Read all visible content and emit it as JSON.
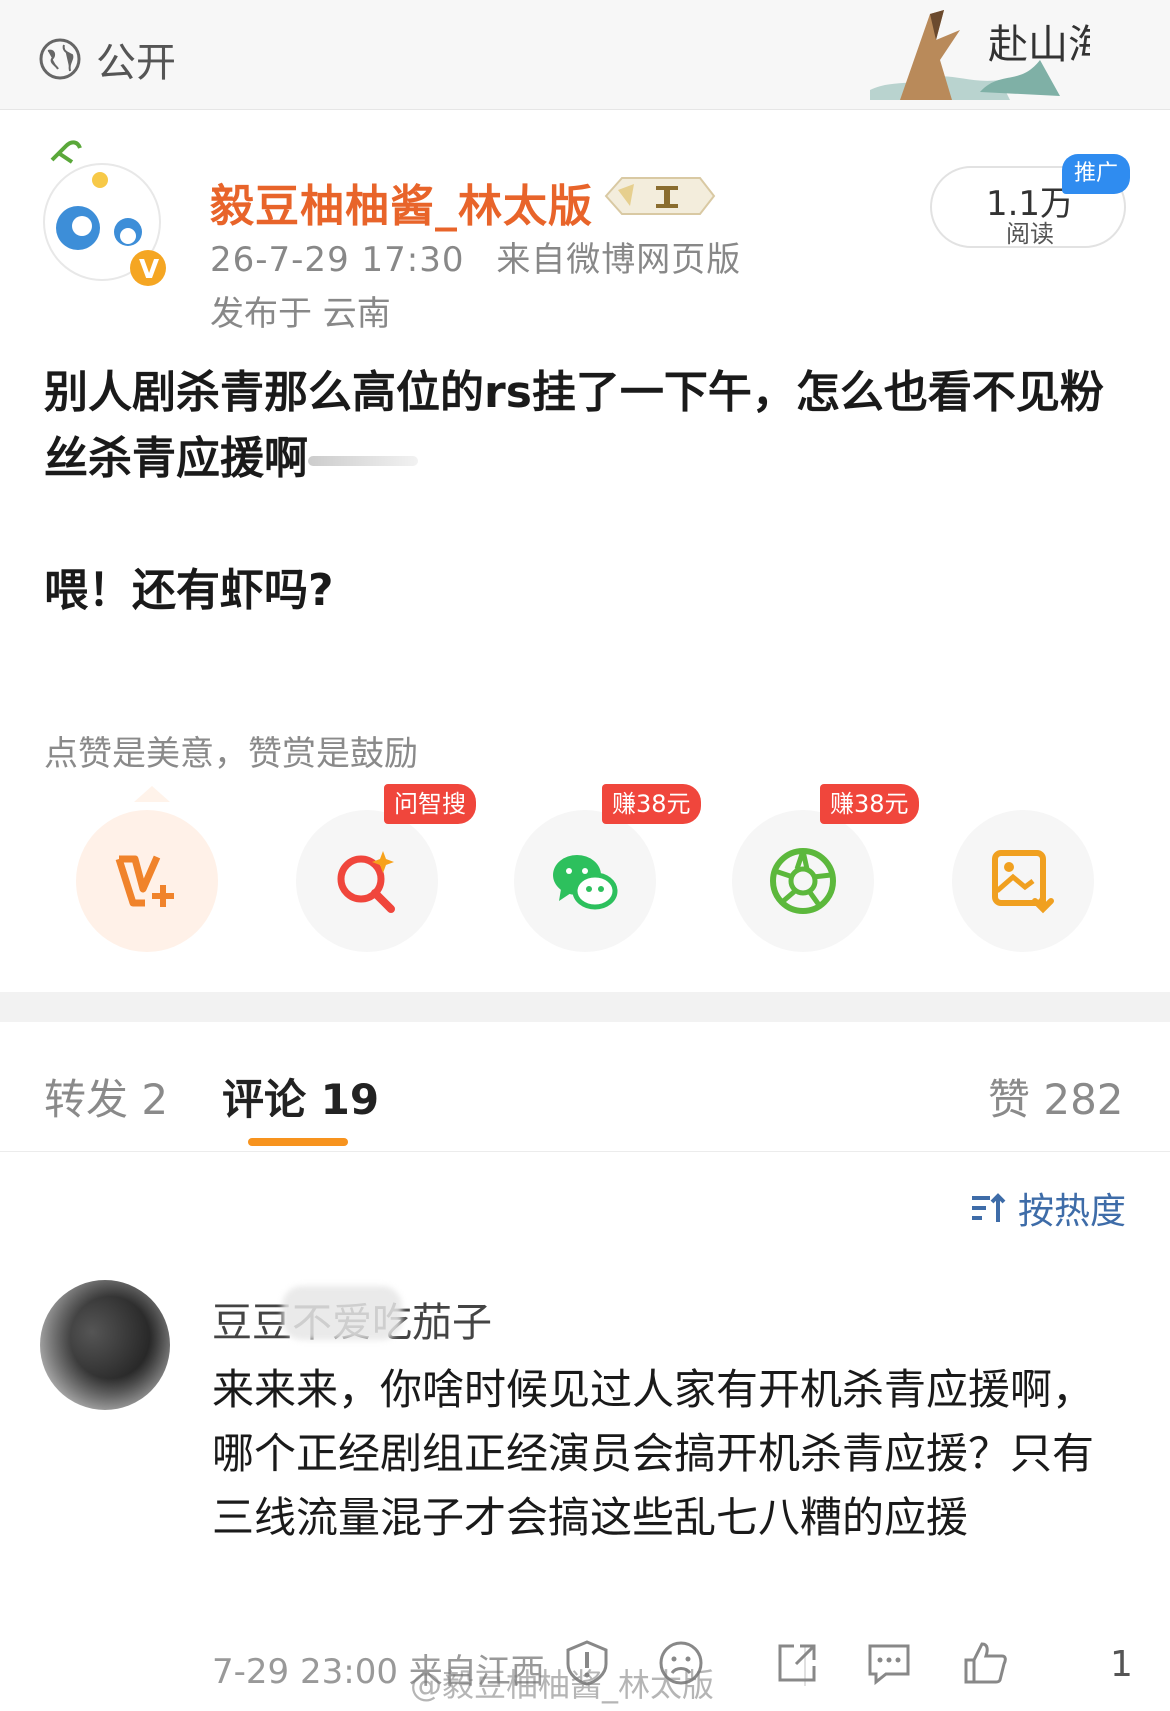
{
  "topbar": {
    "visibility_label": "公开",
    "visibility_icon": "globe-icon",
    "decoration_icon": "ink-mountain-seal-art"
  },
  "post": {
    "username": "毅豆柚柚酱_林太版",
    "time": "26-7-29 17:30",
    "source": "来自微博网页版",
    "location": "发布于 云南",
    "reads": "1.1万",
    "reads_label": "阅读",
    "promo_label": "推广",
    "body_line1": "别人剧杀青那么高位的rs挂了一下午，怎么也看不见粉丝杀青应援啊",
    "body_line2": "喂！还有虾吗?",
    "reward_text": "点赞是美意，赞赏是鼓励"
  },
  "actions": {
    "tag_search": "问智搜",
    "tag_wechat": "赚38元",
    "tag_moments": "赚38元"
  },
  "tabs": {
    "repost": "转发 2",
    "comments": "评论 19",
    "likes": "赞 282"
  },
  "sort_label": "按热度",
  "comment": {
    "name": "豆豆不爱吃茄子",
    "text": "来来来，你啥时候见过人家有开机杀青应援啊，哪个正经剧组正经演员会搞开机杀青应援？只有三线流量混子才会搞这些乱七八糟的应援",
    "time": "7-29 23:00 来自江西",
    "like_count": "1"
  },
  "watermark": "@毅豆柚柚酱_林太版",
  "colors": {
    "username": "#e8642a",
    "accent": "#f7931e",
    "sort": "#3e6ca8",
    "promo": "#2f8cf0",
    "tag": "#f0463c"
  }
}
